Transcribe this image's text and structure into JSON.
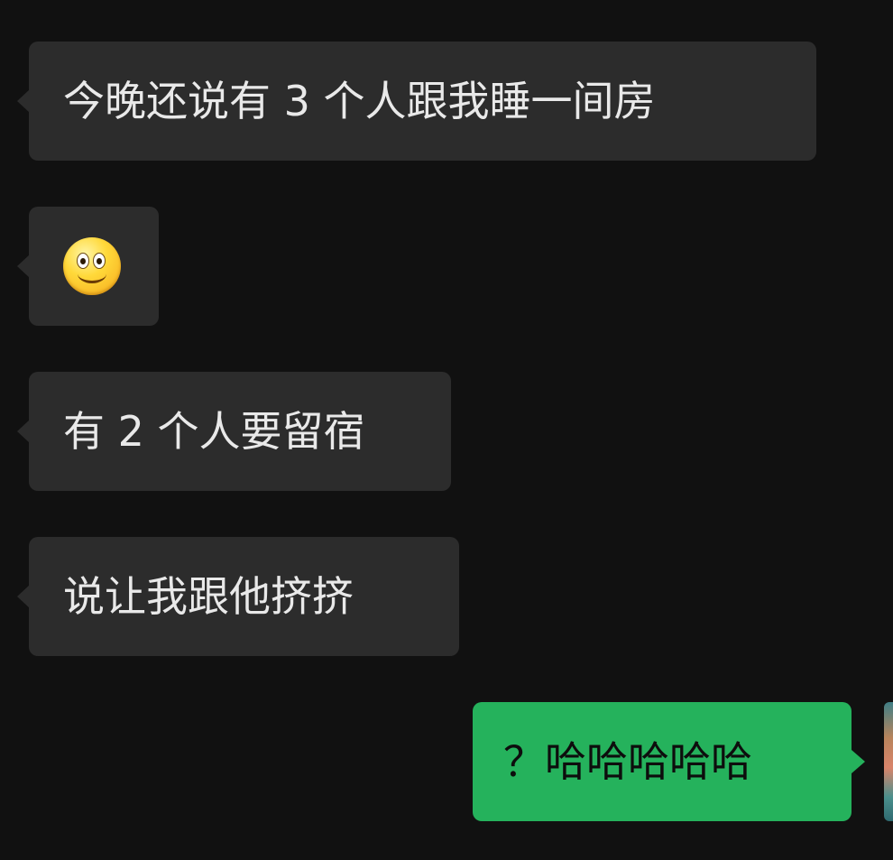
{
  "messages": [
    {
      "side": "received",
      "text": "今晚还说有 3 个人跟我睡一间房"
    },
    {
      "side": "received",
      "emoji": "smiling-face-emoji"
    },
    {
      "side": "received",
      "text": "有 2 个人要留宿"
    },
    {
      "side": "received",
      "text": "说让我跟他挤挤"
    },
    {
      "side": "sent",
      "text": "？哈哈哈哈哈"
    }
  ],
  "colors": {
    "background": "#111111",
    "received_bubble": "#2c2c2c",
    "received_text": "#e9e9e9",
    "sent_bubble": "#25b25c",
    "sent_text": "#0d0d0d"
  }
}
